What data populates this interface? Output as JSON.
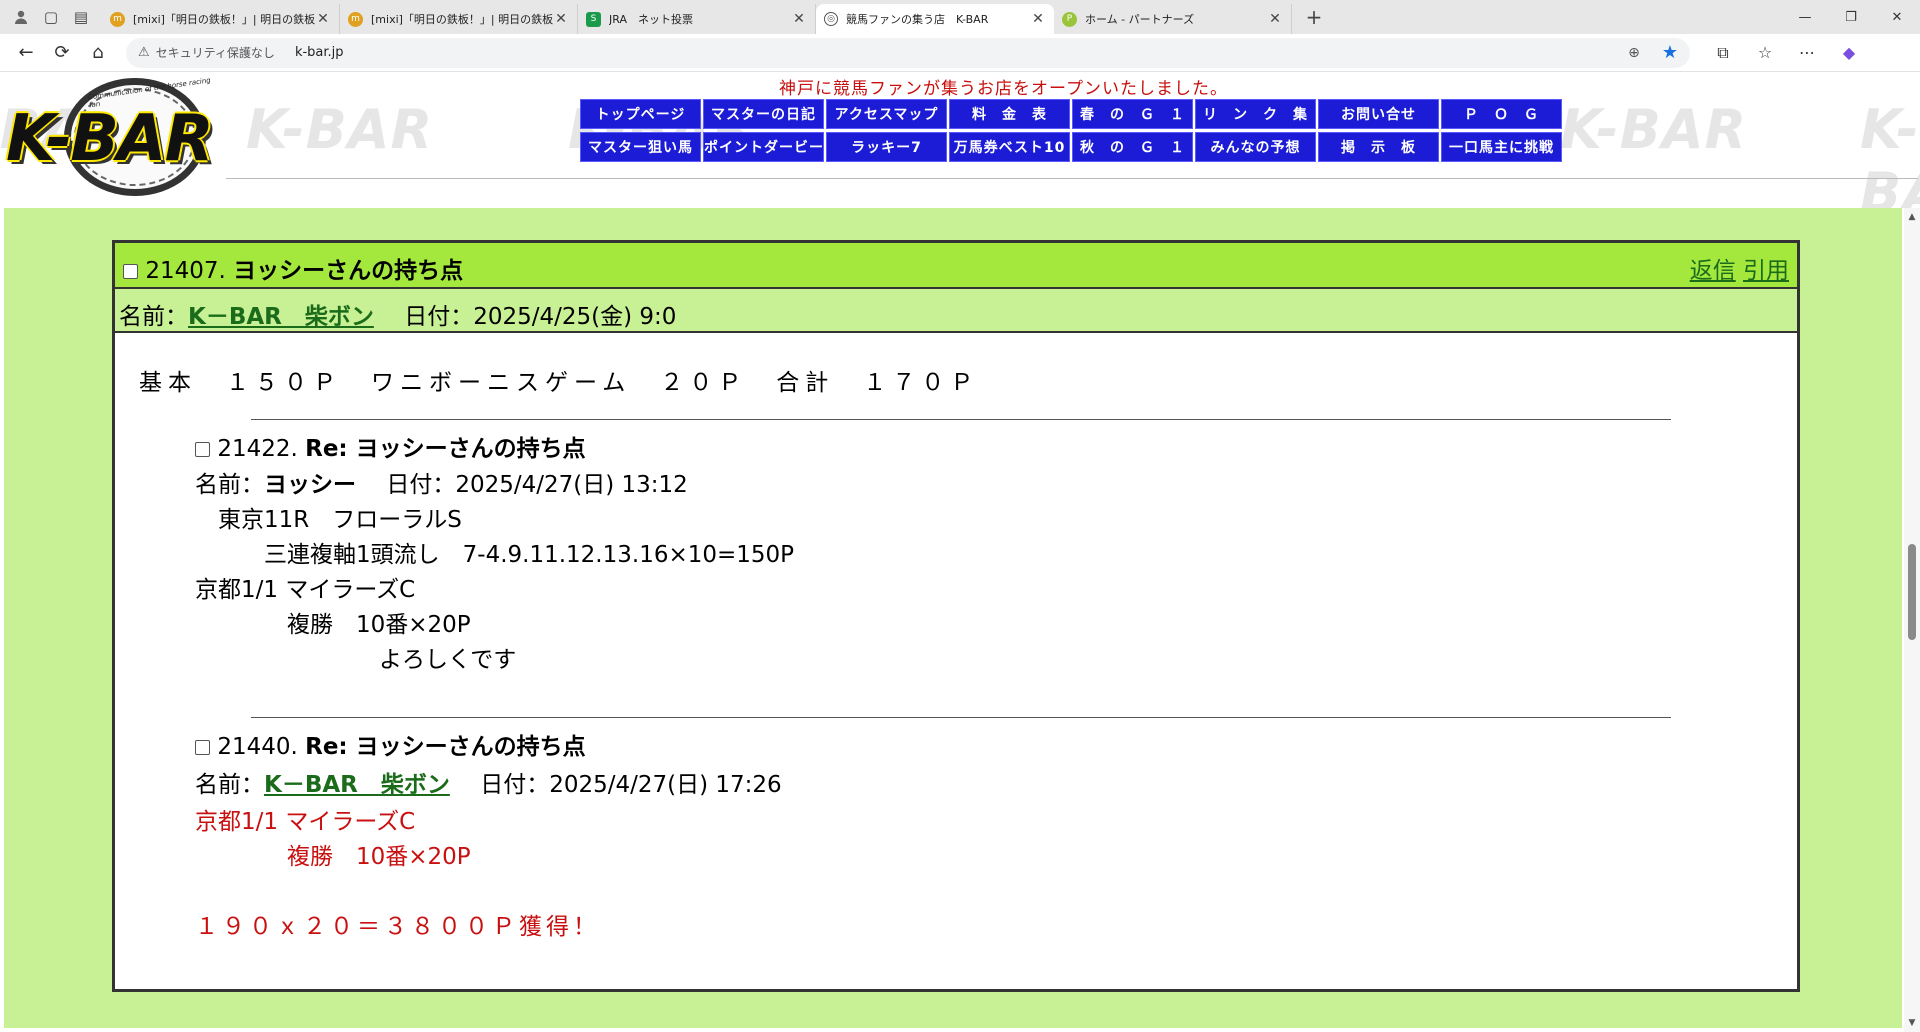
{
  "browser": {
    "tabs": [
      {
        "title": "[mixi]「明日の鉄板！」| 明日の鉄板",
        "favicon_color": "#e0a020",
        "active": false
      },
      {
        "title": "[mixi]「明日の鉄板！」| 明日の鉄板",
        "favicon_color": "#e0a020",
        "active": false
      },
      {
        "title": "JRA　ネット投票",
        "favicon_color": "#1a9a4a",
        "active": false
      },
      {
        "title": "競馬ファンの集う店　K-BAR",
        "favicon_color": "#555555",
        "active": true
      },
      {
        "title": "ホーム - パートナーズ",
        "favicon_color": "#9ac43a",
        "active": false
      }
    ],
    "address": {
      "security_label": "セキュリティ保護なし",
      "url": "k-bar.jp"
    }
  },
  "header": {
    "logo_text": "K-BAR",
    "logo_tagline": "Communication of the horse racing fan",
    "watermark_text": "K-BAR",
    "banner": "神戸に競馬ファンが集うお店をオープンいたしました。",
    "menu": [
      "トップページ",
      "マスターの日記",
      "アクセスマップ",
      "料　金　表",
      "春　の　Ｇ　１",
      "リ　ン　ク　集",
      "お問い合せ",
      "Ｐ　Ｏ　Ｇ",
      "マスター狙い馬",
      "ポイントダービー",
      "ラッキー7",
      "万馬券ベスト10",
      "秋　の　Ｇ　１",
      "みんなの予想",
      "掲　示　板",
      "一口馬主に挑戦"
    ]
  },
  "post": {
    "number": "21407.",
    "title": "ヨッシーさんの持ち点",
    "reply_link": "返信",
    "quote_link": "引用",
    "name_label": "名前：",
    "name": "K－BAR　柴ボン",
    "date_label": "日付：",
    "date": "2025/4/25(金) 9:0",
    "body": "基本　１５０Ｐ　ワニボーニスゲーム　２０Ｐ　合計　１７０Ｐ",
    "replies": [
      {
        "number": "21422.",
        "title": "Re: ヨッシーさんの持ち点",
        "name": "ヨッシー",
        "date": "2025/4/27(日) 13:12",
        "lines": [
          "　東京11R　フローラルS",
          "　　　三連複軸1頭流し　7-4.9.11.12.13.16×10=150P",
          "京都1/1 マイラーズC",
          "　　　　複勝　10番×20P",
          "　　　　　　　　よろしくです"
        ]
      },
      {
        "number": "21440.",
        "title": "Re: ヨッシーさんの持ち点",
        "name": "K－BAR　柴ボン",
        "date": "2025/4/27(日) 17:26",
        "lines": [
          "京都1/1 マイラーズC",
          "　　　　複勝　10番×20P",
          "",
          "１９０ｘ２０＝３８００Ｐ獲得！"
        ]
      }
    ]
  }
}
